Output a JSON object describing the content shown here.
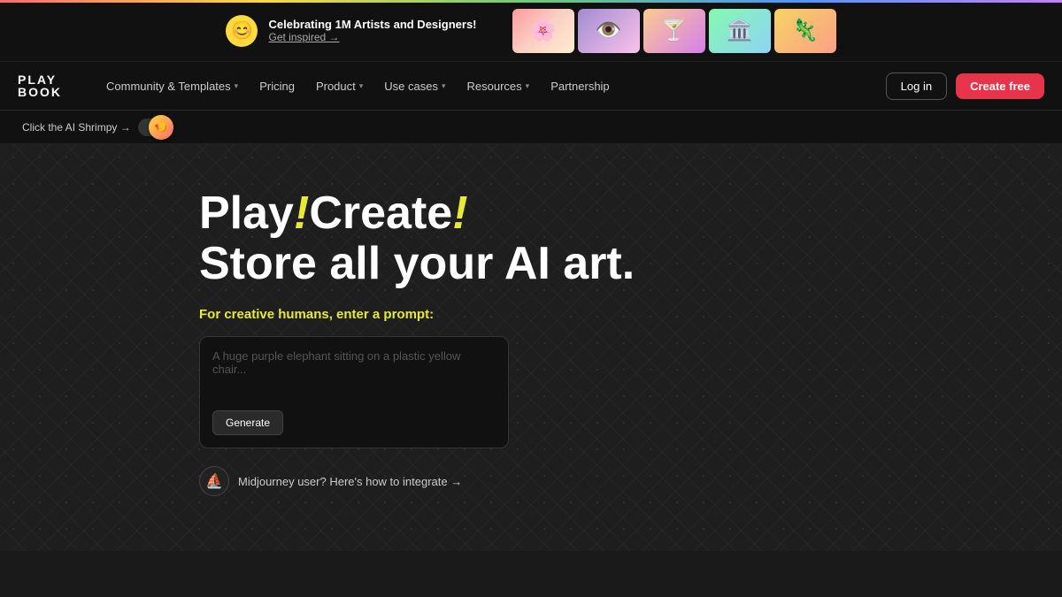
{
  "topBanner": {
    "celebrating_text": "Celebrating 1M Artists and Designers!",
    "get_inspired_link": "Get inspired →",
    "smiley": "😊",
    "images": [
      {
        "id": "img1",
        "alt": "pink floral art",
        "emoji": "🌸"
      },
      {
        "id": "img2",
        "alt": "eye portrait",
        "emoji": "👁️"
      },
      {
        "id": "img3",
        "alt": "cocktail art",
        "emoji": "🍸"
      },
      {
        "id": "img4",
        "alt": "architectural art",
        "emoji": "🏛️"
      },
      {
        "id": "img5",
        "alt": "colorful lizard",
        "emoji": "🦎"
      }
    ]
  },
  "navbar": {
    "logo_play": "PLAY",
    "logo_book": "BOOK",
    "nav_items": [
      {
        "label": "Community & Templates",
        "has_dropdown": true
      },
      {
        "label": "Pricing",
        "has_dropdown": false
      },
      {
        "label": "Product",
        "has_dropdown": true
      },
      {
        "label": "Use cases",
        "has_dropdown": true
      },
      {
        "label": "Resources",
        "has_dropdown": true
      },
      {
        "label": "Partnership",
        "has_dropdown": false
      }
    ],
    "login_label": "Log in",
    "create_label": "Create free"
  },
  "shrimpy_bar": {
    "label": "Click the AI Shrimpy →",
    "toggle_emoji": "🍤"
  },
  "hero": {
    "title_line1_prefix": "Play",
    "title_line1_italic": "!",
    "title_line1_suffix": "Create",
    "title_line1_italic2": "!",
    "title_line2": "Store all your AI art.",
    "subtitle": "For creative humans, enter a prompt:",
    "prompt_placeholder": "A huge purple elephant sitting on a plastic yellow chair...",
    "generate_label": "Generate",
    "midjourney_text": "Midjourney user? Here's how to integrate →",
    "midjourney_icon": "⛵"
  }
}
